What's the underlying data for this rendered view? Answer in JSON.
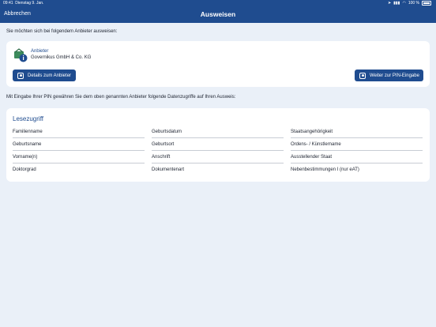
{
  "status": {
    "time": "09:41",
    "date": "Dienstag 9. Jan.",
    "battery": "100 %"
  },
  "nav": {
    "cancel_label": "Abbrechen",
    "title": "Ausweisen"
  },
  "intro_text": "Sie möchten sich bei folgendem Anbieter ausweisen:",
  "provider": {
    "label": "Anbieter",
    "name": "Governikus GmbH & Co. KG",
    "details_button": "Details zum Anbieter",
    "continue_button": "Weiter zur PIN-Eingabe"
  },
  "access": {
    "intro_text": "Mit Eingabe Ihrer PIN gewähren Sie dem oben genannten Anbieter folgende Datenzugriffe auf Ihren Ausweis:",
    "title": "Lesezugriff",
    "columns": [
      [
        "Familienname",
        "Geburtsname",
        "Vorname(n)",
        "Doktorgrad"
      ],
      [
        "Geburtsdatum",
        "Geburtsort",
        "Anschrift",
        "Dokumentenart"
      ],
      [
        "Staatsangehörigkeit",
        "Ordens- / Künstlername",
        "Ausstellender Staat",
        "Nebenbestimmungen I (nur eAT)"
      ]
    ]
  },
  "colors": {
    "brand": "#1f4c8f",
    "background": "#eaf0f8"
  }
}
